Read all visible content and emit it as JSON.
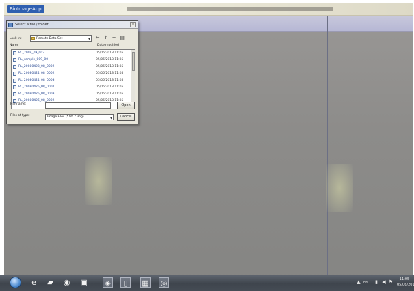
{
  "app": {
    "title": "BioImageApp"
  },
  "dialog": {
    "title": "Select a file / folder",
    "close_glyph": "×",
    "look_in_label": "Look in:",
    "look_in_value": "Remote Data Set",
    "toolbar": [
      {
        "name": "back-icon",
        "glyph": "←"
      },
      {
        "name": "up-folder-icon",
        "glyph": "↑"
      },
      {
        "name": "new-folder-icon",
        "glyph": "+"
      },
      {
        "name": "view-menu-icon",
        "glyph": "▤"
      }
    ],
    "columns": {
      "name": "Name",
      "date": "Date modified"
    },
    "files": [
      {
        "name": "RL_2009_09_002",
        "date": "05/06/2013 11:05"
      },
      {
        "name": "RL_sample_009_00",
        "date": "05/06/2013 11:05"
      },
      {
        "name": "RL_20080423_08_0002",
        "date": "05/06/2013 11:05"
      },
      {
        "name": "RL_20080424_08_0002",
        "date": "05/06/2013 11:05"
      },
      {
        "name": "RL_20080424_08_0003",
        "date": "05/06/2013 11:05"
      },
      {
        "name": "RL_20080425_08_0002",
        "date": "05/06/2013 11:05"
      },
      {
        "name": "RL_20080425_08_0003",
        "date": "05/06/2013 11:05"
      },
      {
        "name": "RL_20080426_08_0002",
        "date": "05/06/2013 11:05"
      }
    ],
    "file_name_label": "File name:",
    "file_name_value": "",
    "file_type_label": "Files of type:",
    "file_type_value": "Image Files (*.tif, *.img)",
    "open_button": "Open",
    "cancel_button": "Cancel"
  },
  "taskbar": {
    "icons": [
      {
        "name": "browser-icon",
        "glyph": "e"
      },
      {
        "name": "file-explorer-icon",
        "glyph": "▰"
      },
      {
        "name": "media-player-icon",
        "glyph": "◉"
      },
      {
        "name": "terminal-icon",
        "glyph": "▣"
      },
      {
        "name": "app-window-icon",
        "glyph": "◈"
      },
      {
        "name": "document-icon",
        "glyph": "▯"
      },
      {
        "name": "image-viewer-icon",
        "glyph": "▦"
      },
      {
        "name": "running-app-icon",
        "glyph": "◎"
      }
    ],
    "tray_text": "EN",
    "clock_time": "11:05",
    "clock_date": "05/06/2013"
  },
  "colors": {
    "taskbar": "#454c55",
    "dialog_background": "#e9e7dc",
    "file_link": "#1d3f8c",
    "app_title_bar": "#2f5fb0"
  }
}
